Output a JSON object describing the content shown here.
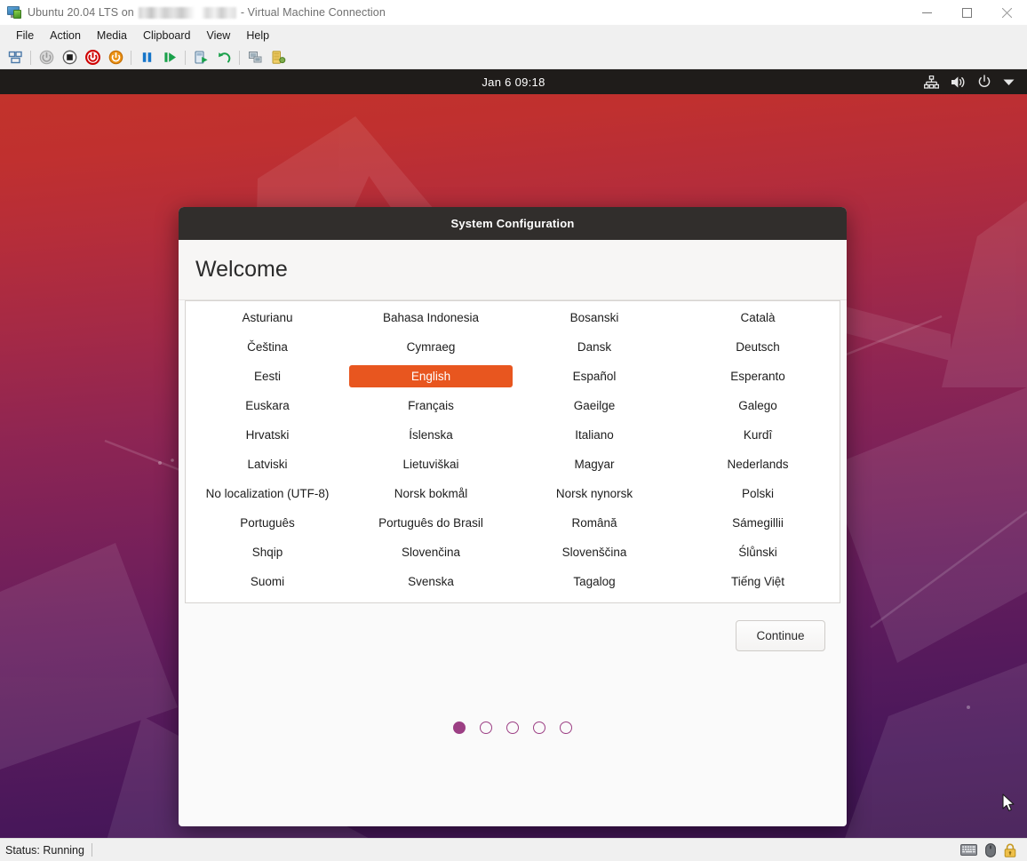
{
  "host_window": {
    "title_prefix": "Ubuntu 20.04 LTS on",
    "title_suffix": "- Virtual Machine Connection",
    "app_icon": "virtual-machine-icon",
    "controls": {
      "minimize": "minimize-icon",
      "maximize": "maximize-icon",
      "close": "close-icon"
    },
    "menus": [
      "File",
      "Action",
      "Media",
      "Clipboard",
      "View",
      "Help"
    ],
    "toolbar": [
      {
        "name": "thumbnail-view-button",
        "icon": "thumbnail-icon"
      },
      {
        "name": "separator-1",
        "icon": "separator"
      },
      {
        "name": "power-on-button",
        "icon": "power-grey-icon"
      },
      {
        "name": "turn-off-button",
        "icon": "stop-square-icon"
      },
      {
        "name": "shut-down-button",
        "icon": "power-red-icon"
      },
      {
        "name": "save-button",
        "icon": "power-orange-icon"
      },
      {
        "name": "separator-2",
        "icon": "separator"
      },
      {
        "name": "pause-button",
        "icon": "pause-icon"
      },
      {
        "name": "resume-button",
        "icon": "play-icon"
      },
      {
        "name": "separator-3",
        "icon": "separator"
      },
      {
        "name": "checkpoint-button",
        "icon": "checkpoint-icon"
      },
      {
        "name": "revert-button",
        "icon": "revert-arrow-icon"
      },
      {
        "name": "separator-4",
        "icon": "separator"
      },
      {
        "name": "enhanced-session-button",
        "icon": "enhanced-session-icon"
      },
      {
        "name": "settings-button",
        "icon": "settings-server-icon"
      }
    ]
  },
  "statusbar": {
    "status": "Status: Running",
    "icons": [
      "keyboard-icon",
      "mouse-icon",
      "lock-icon"
    ]
  },
  "vm": {
    "topbar": {
      "clock": "Jan 6  09:18",
      "tray": [
        "network-icon",
        "volume-icon",
        "power-icon",
        "chevron-down-icon"
      ]
    }
  },
  "dialog": {
    "title": "System Configuration",
    "heading": "Welcome",
    "languages": [
      "Asturianu",
      "Bahasa Indonesia",
      "Bosanski",
      "Català",
      "Čeština",
      "Cymraeg",
      "Dansk",
      "Deutsch",
      "Eesti",
      "English",
      "Español",
      "Esperanto",
      "Euskara",
      "Français",
      "Gaeilge",
      "Galego",
      "Hrvatski",
      "Íslenska",
      "Italiano",
      "Kurdî",
      "Latviski",
      "Lietuviškai",
      "Magyar",
      "Nederlands",
      "No localization (UTF-8)",
      "Norsk bokmål",
      "Norsk nynorsk",
      "Polski",
      "Português",
      "Português do Brasil",
      "Română",
      "Sámegillii",
      "Shqip",
      "Slovenčina",
      "Slovenščina",
      "Ślůnski",
      "Suomi",
      "Svenska",
      "Tagalog",
      "Tiếng Việt"
    ],
    "selected_language": "English",
    "continue_label": "Continue",
    "pagination": {
      "total": 5,
      "active_index": 0
    }
  },
  "colors": {
    "ubuntu_orange": "#e8561f",
    "dialog_header": "#312e2c",
    "gnome_topbar": "#1f1c1a",
    "dot_purple": "#9c3f84"
  }
}
